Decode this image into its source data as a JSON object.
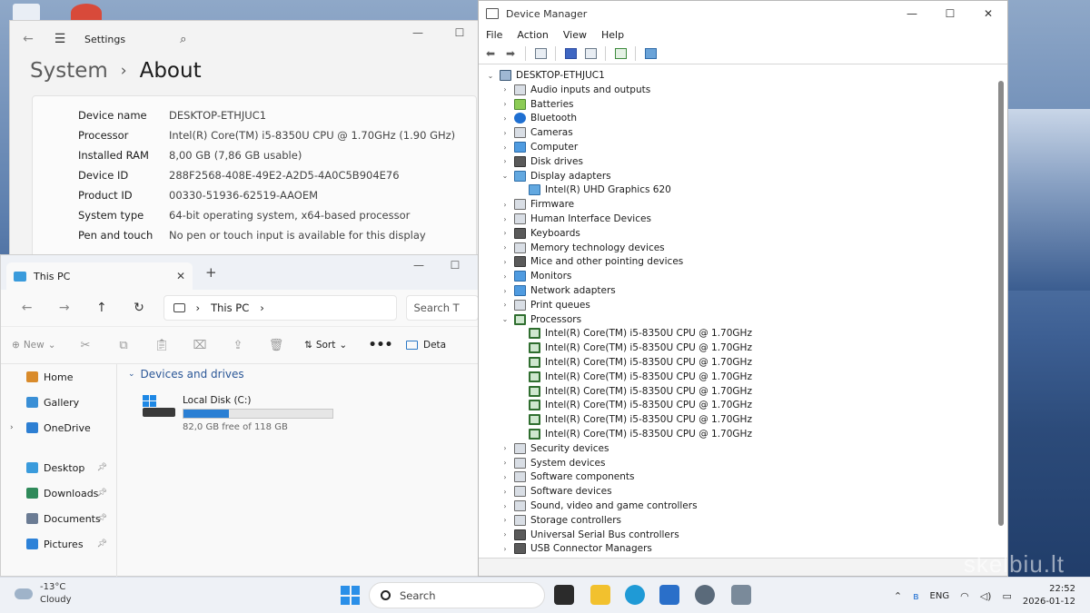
{
  "settings": {
    "title": "Settings",
    "breadcrumb_parent": "System",
    "breadcrumb_separator": "›",
    "breadcrumb_current": "About",
    "specs": [
      {
        "key": "Device name",
        "value": "DESKTOP-ETHJUC1"
      },
      {
        "key": "Processor",
        "value": "Intel(R) Core(TM) i5-8350U CPU @ 1.70GHz (1.90 GHz)"
      },
      {
        "key": "Installed RAM",
        "value": "8,00 GB (7,86 GB usable)"
      },
      {
        "key": "Device ID",
        "value": "288F2568-408E-49E2-A2D5-4A0C5B904E76"
      },
      {
        "key": "Product ID",
        "value": "00330-51936-62519-AAOEM"
      },
      {
        "key": "System type",
        "value": "64-bit operating system, x64-based processor"
      },
      {
        "key": "Pen and touch",
        "value": "No pen or touch input is available for this display"
      }
    ]
  },
  "explorer": {
    "tab_label": "This PC",
    "address_path": "This PC",
    "search_placeholder": "Search T",
    "toolbar": {
      "new_label": "New",
      "sort_label": "Sort",
      "more_label": "•••",
      "details_label": "Deta"
    },
    "nav_items": [
      {
        "label": "Home",
        "pinned": false,
        "color": "#d98b2b"
      },
      {
        "label": "Gallery",
        "pinned": false,
        "color": "#3a8fd6"
      },
      {
        "label": "OneDrive",
        "pinned": false,
        "color": "#2d7fd3"
      },
      {
        "label": "Desktop",
        "pinned": true,
        "color": "#3a9bdc"
      },
      {
        "label": "Downloads",
        "pinned": true,
        "color": "#2f8a5a"
      },
      {
        "label": "Documents",
        "pinned": true,
        "color": "#6b7c94"
      },
      {
        "label": "Pictures",
        "pinned": true,
        "color": "#2d82d8"
      }
    ],
    "group_header": "Devices and drives",
    "drive": {
      "name": "Local Disk (C:)",
      "free_text": "82,0 GB free of 118 GB",
      "used_fraction": 0.305
    }
  },
  "devmgr": {
    "title": "Device Manager",
    "menu": [
      "File",
      "Action",
      "View",
      "Help"
    ],
    "root": "DESKTOP-ETHJUC1",
    "nodes": [
      {
        "label": "Audio inputs and outputs",
        "expanded": false,
        "icon": "speaker-icon"
      },
      {
        "label": "Batteries",
        "expanded": false,
        "icon": "battery-icon"
      },
      {
        "label": "Bluetooth",
        "expanded": false,
        "icon": "bluetooth-icon"
      },
      {
        "label": "Cameras",
        "expanded": false,
        "icon": "camera-icon"
      },
      {
        "label": "Computer",
        "expanded": false,
        "icon": "computer-icon"
      },
      {
        "label": "Disk drives",
        "expanded": false,
        "icon": "disk-icon"
      },
      {
        "label": "Display adapters",
        "expanded": true,
        "icon": "display-adapter-icon",
        "children": [
          "Intel(R) UHD Graphics 620"
        ]
      },
      {
        "label": "Firmware",
        "expanded": false,
        "icon": "firmware-icon"
      },
      {
        "label": "Human Interface Devices",
        "expanded": false,
        "icon": "hid-icon"
      },
      {
        "label": "Keyboards",
        "expanded": false,
        "icon": "keyboard-icon"
      },
      {
        "label": "Memory technology devices",
        "expanded": false,
        "icon": "memory-icon"
      },
      {
        "label": "Mice and other pointing devices",
        "expanded": false,
        "icon": "mouse-icon"
      },
      {
        "label": "Monitors",
        "expanded": false,
        "icon": "monitor-icon"
      },
      {
        "label": "Network adapters",
        "expanded": false,
        "icon": "network-icon"
      },
      {
        "label": "Print queues",
        "expanded": false,
        "icon": "printer-icon"
      },
      {
        "label": "Processors",
        "expanded": true,
        "icon": "processor-icon",
        "children": [
          "Intel(R) Core(TM) i5-8350U CPU @ 1.70GHz",
          "Intel(R) Core(TM) i5-8350U CPU @ 1.70GHz",
          "Intel(R) Core(TM) i5-8350U CPU @ 1.70GHz",
          "Intel(R) Core(TM) i5-8350U CPU @ 1.70GHz",
          "Intel(R) Core(TM) i5-8350U CPU @ 1.70GHz",
          "Intel(R) Core(TM) i5-8350U CPU @ 1.70GHz",
          "Intel(R) Core(TM) i5-8350U CPU @ 1.70GHz",
          "Intel(R) Core(TM) i5-8350U CPU @ 1.70GHz"
        ]
      },
      {
        "label": "Security devices",
        "expanded": false,
        "icon": "security-icon"
      },
      {
        "label": "System devices",
        "expanded": false,
        "icon": "system-devices-icon"
      },
      {
        "label": "Software components",
        "expanded": false,
        "icon": "software-component-icon"
      },
      {
        "label": "Software devices",
        "expanded": false,
        "icon": "software-device-icon"
      },
      {
        "label": "Sound, video and game controllers",
        "expanded": false,
        "icon": "sound-icon"
      },
      {
        "label": "Storage controllers",
        "expanded": false,
        "icon": "storage-icon"
      },
      {
        "label": "Universal Serial Bus controllers",
        "expanded": false,
        "icon": "usb-icon"
      },
      {
        "label": "USB Connector Managers",
        "expanded": false,
        "icon": "usb-connector-icon"
      }
    ]
  },
  "taskbar": {
    "weather_temp": "-13°C",
    "weather_desc": "Cloudy",
    "search_label": "Search",
    "language": "ENG",
    "time": "22:52",
    "date": "2026-01-12"
  },
  "watermark": "skelbiu.lt"
}
